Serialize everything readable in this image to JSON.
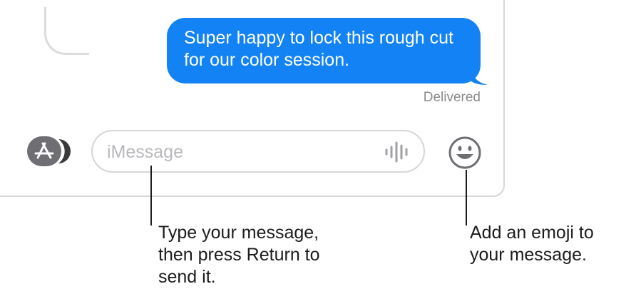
{
  "conversation": {
    "message_text": "Super happy to lock this rough cut for our color session.",
    "status": "Delivered",
    "bubble_color": "#1282f4"
  },
  "composer": {
    "placeholder": "iMessage",
    "app_button_icon": "app-store-icon",
    "audio_icon": "audio-waveform-icon",
    "emoji_icon": "smiley-face-icon"
  },
  "callouts": {
    "message_field": [
      "Type your message,",
      "then press Return to",
      "send it."
    ],
    "emoji": [
      "Add an emoji to",
      "your message."
    ]
  }
}
